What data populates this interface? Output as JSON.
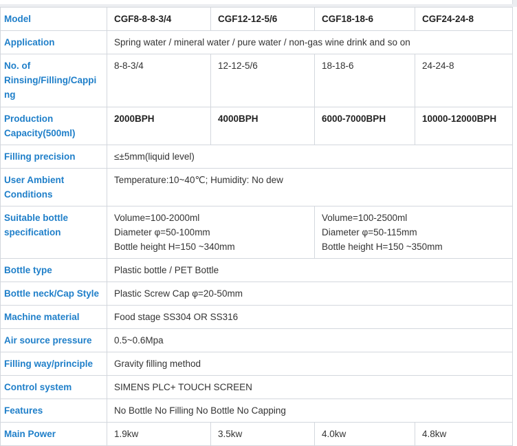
{
  "header": {
    "label": "Model",
    "models": [
      "CGF8-8-8-3/4",
      "CGF12-12-5/6",
      "CGF18-18-6",
      "CGF24-24-8"
    ]
  },
  "rows": {
    "application": {
      "label": "Application",
      "value": "Spring water / mineral water / pure water / non-gas wine drink and so on"
    },
    "heads": {
      "label_lines": [
        "No. of",
        "Rinsing/Filling/Cappi",
        "ng"
      ],
      "values": [
        "8-8-3/4",
        "12-12-5/6",
        "18-18-6",
        "24-24-8"
      ]
    },
    "capacity": {
      "label_lines": [
        "Production",
        "Capacity(500ml)"
      ],
      "values": [
        "2000BPH",
        "4000BPH",
        "6000-7000BPH",
        "10000-12000BPH"
      ]
    },
    "precision": {
      "label": "Filling precision",
      "value": "≤±5mm(liquid level)"
    },
    "ambient": {
      "label_lines": [
        "User Ambient",
        "Conditions"
      ],
      "value": "Temperature:10~40℃; Humidity: No dew"
    },
    "bottle_spec": {
      "label_lines": [
        "Suitable bottle",
        "specification"
      ],
      "left_lines": [
        "Volume=100-2000ml",
        "Diameter φ=50-100mm",
        "Bottle height H=150 ~340mm"
      ],
      "right_lines": [
        "Volume=100-2500ml",
        "Diameter φ=50-115mm",
        "Bottle height H=150 ~350mm"
      ]
    },
    "bottle_type": {
      "label": "Bottle type",
      "value": "Plastic bottle / PET Bottle"
    },
    "cap_style": {
      "label": "Bottle neck/Cap Style",
      "value": "Plastic Screw Cap φ=20-50mm"
    },
    "material": {
      "label": "Machine material",
      "value": "Food stage SS304 OR SS316"
    },
    "air": {
      "label": "Air source pressure",
      "value": "0.5~0.6Mpa"
    },
    "filling_way": {
      "label": "Filling way/principle",
      "value": "Gravity filling method"
    },
    "control": {
      "label": "Control system",
      "value": "SIMENS PLC+ TOUCH SCREEN"
    },
    "features": {
      "label": "Features",
      "value": "No Bottle No Filling No Bottle No Capping"
    },
    "power": {
      "label": "Main Power",
      "values": [
        "1.9kw",
        "3.5kw",
        "4.0kw",
        "4.8kw"
      ]
    }
  },
  "colors": {
    "label_text": "#1f7fc9",
    "border": "#d3d7dd",
    "body_text": "#333333"
  }
}
